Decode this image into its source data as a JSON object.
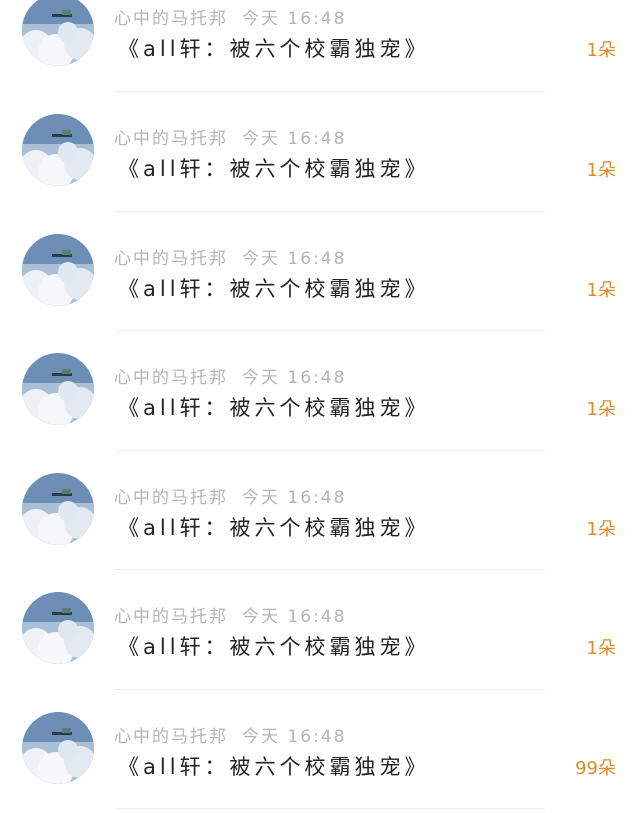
{
  "items": [
    {
      "author": "心中的马托邦",
      "time": "今天 16:48",
      "title": "《all轩：被六个校霸独宠》",
      "count": "1朵"
    },
    {
      "author": "心中的马托邦",
      "time": "今天 16:48",
      "title": "《all轩：被六个校霸独宠》",
      "count": "1朵"
    },
    {
      "author": "心中的马托邦",
      "time": "今天 16:48",
      "title": "《all轩：被六个校霸独宠》",
      "count": "1朵"
    },
    {
      "author": "心中的马托邦",
      "time": "今天 16:48",
      "title": "《all轩：被六个校霸独宠》",
      "count": "1朵"
    },
    {
      "author": "心中的马托邦",
      "time": "今天 16:48",
      "title": "《all轩：被六个校霸独宠》",
      "count": "1朵"
    },
    {
      "author": "心中的马托邦",
      "time": "今天 16:48",
      "title": "《all轩：被六个校霸独宠》",
      "count": "1朵"
    },
    {
      "author": "心中的马托邦",
      "time": "今天 16:48",
      "title": "《all轩：被六个校霸独宠》",
      "count": "99朵"
    }
  ]
}
